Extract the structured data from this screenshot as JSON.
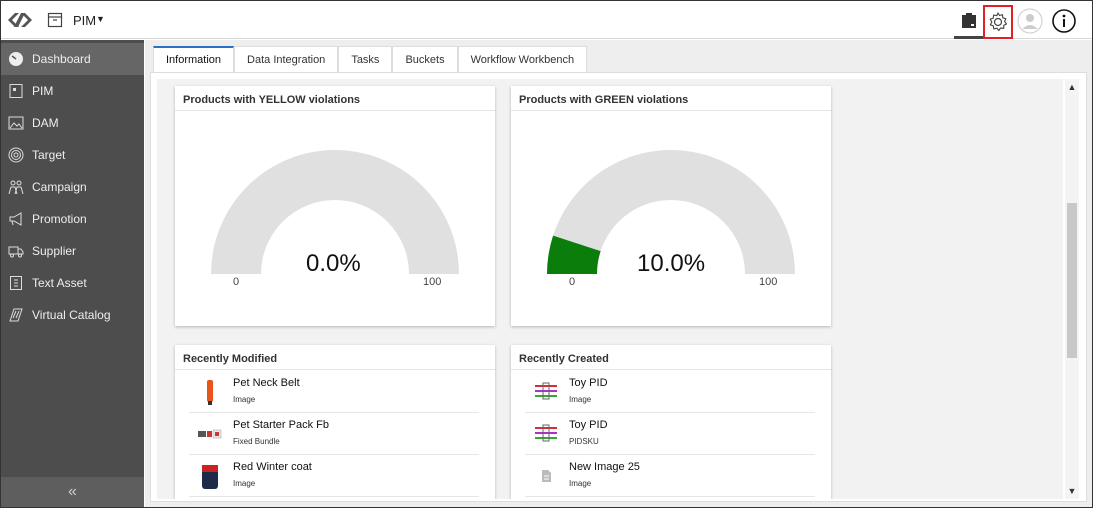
{
  "header": {
    "module_label": "PIM",
    "logo_icon": "logo-icon",
    "module_icon": "archive-box-icon",
    "reports_icon": "reports-icon",
    "settings_icon": "gear-icon",
    "user_icon": "user-avatar-icon",
    "info_icon": "info-icon",
    "highlight_color": "#e01f26"
  },
  "sidebar": {
    "items": [
      {
        "label": "Dashboard",
        "icon": "dashboard-gauge-icon",
        "active": true
      },
      {
        "label": "PIM",
        "icon": "pim-icon"
      },
      {
        "label": "DAM",
        "icon": "image-icon"
      },
      {
        "label": "Target",
        "icon": "target-icon"
      },
      {
        "label": "Campaign",
        "icon": "campaign-icon"
      },
      {
        "label": "Promotion",
        "icon": "megaphone-icon"
      },
      {
        "label": "Supplier",
        "icon": "truck-icon"
      },
      {
        "label": "Text Asset",
        "icon": "text-document-icon"
      },
      {
        "label": "Virtual Catalog",
        "icon": "virtual-catalog-icon"
      }
    ],
    "collapse_glyph": "«"
  },
  "tabs": [
    {
      "label": "Information",
      "active": true
    },
    {
      "label": "Data Integration"
    },
    {
      "label": "Tasks"
    },
    {
      "label": "Buckets"
    },
    {
      "label": "Workflow Workbench"
    }
  ],
  "cards": {
    "yellow": {
      "title": "Products with YELLOW violations",
      "value_text": "0.0%",
      "value": 0.0,
      "min": "0",
      "max": "100"
    },
    "green": {
      "title": "Products with GREEN violations",
      "value_text": "10.0%",
      "value": 10.0,
      "min": "0",
      "max": "100",
      "fill_color": "#0a7d0a"
    },
    "recently_modified": {
      "title": "Recently Modified",
      "items": [
        {
          "name": "Pet Neck Belt",
          "type": "Image"
        },
        {
          "name": "Pet Starter Pack Fb",
          "type": "Fixed Bundle"
        },
        {
          "name": "Red Winter coat",
          "type": "Image"
        }
      ]
    },
    "recently_created": {
      "title": "Recently Created",
      "items": [
        {
          "name": "Toy PID",
          "type": "Image"
        },
        {
          "name": "Toy PID",
          "type": "PIDSKU"
        },
        {
          "name": "New Image 25",
          "type": "Image"
        }
      ]
    }
  },
  "gauge_colors": {
    "track": "#e0e0e0"
  }
}
